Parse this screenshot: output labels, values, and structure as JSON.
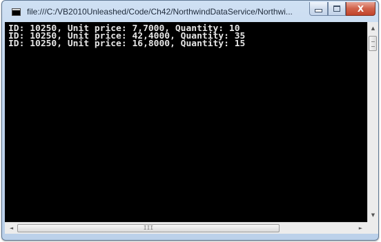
{
  "window": {
    "title": "file:///C:/VB2010Unleashed/Code/Ch42/NorthwindDataService/Northwi...",
    "buttons": {
      "minimize": "",
      "maximize": "",
      "close": "X"
    }
  },
  "console": {
    "lines": [
      "ID: 10250, Unit price: 7,7000, Quantity: 10",
      "ID: 10250, Unit price: 42,4000, Quantity: 35",
      "ID: 10250, Unit price: 16,8000, Quantity: 15"
    ]
  },
  "scrollbars": {
    "vertical": {
      "up": "▲",
      "down": "▼"
    },
    "horizontal": {
      "left": "◄",
      "right": "►",
      "grip": "III"
    }
  },
  "colors": {
    "console_bg": "#000000",
    "console_text": "#e6e6e6",
    "close_button": "#c8503a"
  }
}
